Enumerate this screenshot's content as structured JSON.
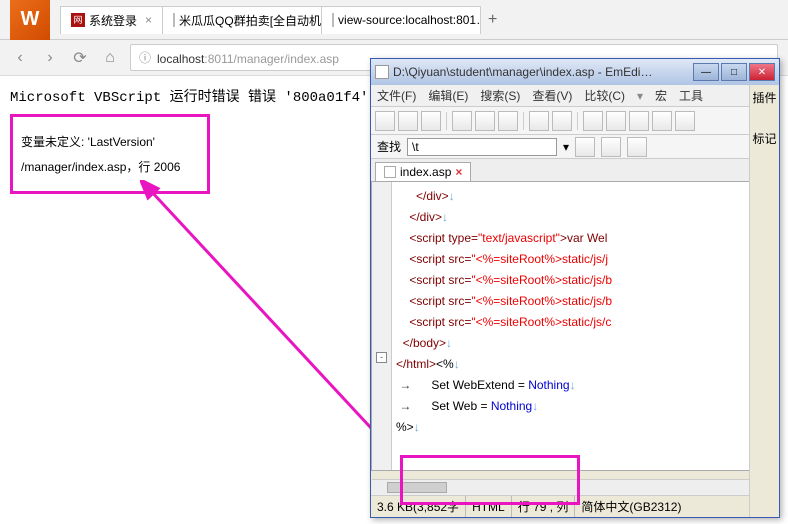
{
  "browser": {
    "tabs": [
      {
        "favicon": "red",
        "label": "系统登录"
      },
      {
        "favicon": "page",
        "label": "米瓜瓜QQ群拍卖[全自动机…"
      },
      {
        "favicon": "page",
        "label": "view-source:localhost:801…"
      }
    ],
    "url_prefix": "localhost",
    "url_rest": ":8011/manager/index.asp"
  },
  "error": {
    "title": "Microsoft VBScript 运行时错误  错误 '800a01f4'",
    "msg1": "变量未定义: 'LastVersion'",
    "msg2": "/manager/index.asp，行 2006"
  },
  "editor": {
    "title": "D:\\Qiyuan\\student\\manager\\index.asp - EmEdi…",
    "menu": [
      "文件(F)",
      "编辑(E)",
      "搜索(S)",
      "查看(V)",
      "比较(C)",
      "宏",
      "工具"
    ],
    "side": [
      "插件",
      "标记"
    ],
    "search_label": "查找",
    "search_value": "\\t",
    "tab": "index.asp",
    "status": {
      "size": "3.6 KB(3,852字",
      "type": "HTML",
      "pos": "行 79 , 列",
      "enc": "简体中文(GB2312)"
    }
  },
  "code": {
    "l1": "      </div>",
    "l2": "    </div>",
    "l3a": "    <script type=",
    "l3b": "\"text/javascript\"",
    "l3c": ">var Wel",
    "l4a": "    <script src=",
    "l4b": "\"<%=siteRoot%>static/js/j",
    "l5a": "    <script src=",
    "l5b": "\"<%=siteRoot%>static/js/b",
    "l6a": "    <script src=",
    "l6b": "\"<%=siteRoot%>static/js/b",
    "l7a": "    <script src=",
    "l7b": "\"<%=siteRoot%>static/js/c",
    "l8": "  </body>",
    "l9a": "</html>",
    "l9b": "<%",
    "l10a": "    Set WebExtend = ",
    "l10b": "Nothing",
    "l11a": "    Set Web = ",
    "l11b": "Nothing",
    "l12": "%>"
  }
}
